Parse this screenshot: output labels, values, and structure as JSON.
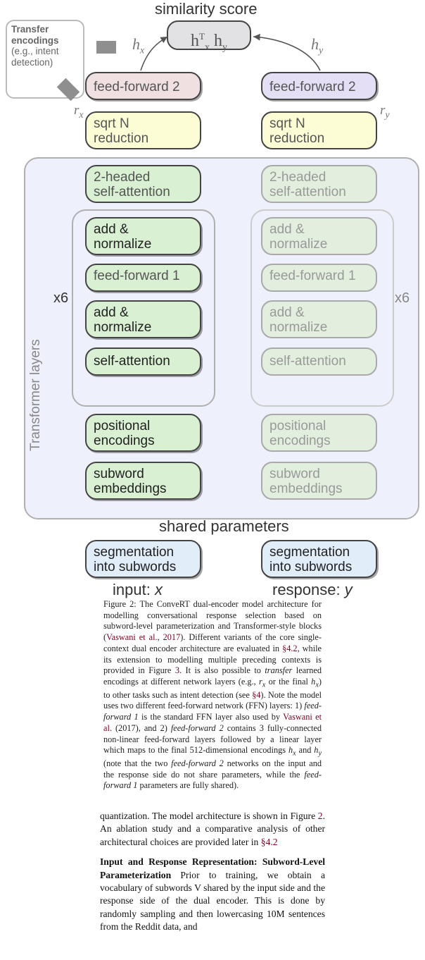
{
  "diagram": {
    "top_label": "similarity score",
    "score_box": "hₓᵀ hᵧ",
    "hx": "h",
    "hx_sub": "x",
    "hy": "h",
    "hy_sub": "y",
    "rx": "r",
    "rx_sub": "x",
    "ry": "r",
    "ry_sub": "y",
    "transfer_title": "Transfer encodings",
    "transfer_sub": "(e.g., intent detection)",
    "ff2_left": "feed-forward 2",
    "ff2_right": "feed-forward 2",
    "sqrtN_left": "sqrt N\nreduction",
    "sqrtN_right": "sqrt N\nreduction",
    "twohead_left": "2-headed\nself-attention",
    "twohead_right": "2-headed\nself-attention",
    "addnorm1_left": "add &\nnormalize",
    "addnorm1_right": "add &\nnormalize",
    "ff1_left": "feed-forward 1",
    "ff1_right": "feed-forward 1",
    "addnorm2_left": "add &\nnormalize",
    "addnorm2_right": "add &\nnormalize",
    "selfattn_left": "self-attention",
    "selfattn_right": "self-attention",
    "posenc_left": "positional\nencodings",
    "posenc_right": "positional\nencodings",
    "subword_left": "subword\nembeddings",
    "subword_right": "subword\nembeddings",
    "seg_left": "segmentation\ninto subwords",
    "seg_right": "segmentation\ninto subwords",
    "x6": "x6",
    "shared": "shared parameters",
    "transformer_label": "Transformer layers",
    "input_label": "input: x",
    "response_label": "response: y"
  },
  "caption": {
    "lead": "Figure 2: The ConveRT dual-encoder model architecture for modelling conversational response selection based on subword-level parameterization and Transformer-style blocks (",
    "ref_vaswani": "Vaswani et al., 2017",
    "after_vaswani": "). Different variants of the core single-context dual encoder architecture are evaluated in ",
    "sec42": "§4.2",
    "after42": ", while its extension to modelling multiple preceding contexts is provided in Figure ",
    "fig3": "3",
    "afterfig3": ". It is also possible to ",
    "it_transfer": "transfer",
    "after_transfer": " learned encodings at different network layers (e.g., ",
    "rx": "r",
    "rx_sub": "x",
    "or": " or the final ",
    "hx": "h",
    "hx_sub": "x",
    "after_hr": ") to other tasks such as intent detection (see ",
    "sec4": "§4",
    "after4": "). Note the model uses two different feed-forward network (FFN) layers: 1) ",
    "ff1": "feed-forward 1",
    "after_ff1": " is the standard FFN layer also used by ",
    "ref_vaswani2": "Vaswani et al.",
    "vaswani_year": " (2017)",
    "after_vaswani2": ", and 2) ",
    "ff2": "feed-forward 2",
    "after_ff2": " contains 3 fully-connected non-linear feed-forward layers followed by a linear layer which maps to the final 512-dimensional encodings ",
    "hx2": "h",
    "hx2_sub": "x",
    "and": " and ",
    "hy2": "h",
    "hy2_sub": "y",
    "tail": " (note that the two ",
    "ff2b": "feed-forward 2",
    "tail2": " networks on the input and the response side do not share parameters, while the ",
    "ff1b": "feed-forward 1",
    "tail3": " parameters are fully shared)."
  },
  "body": {
    "p1a": "quantization. The model architecture is shown in Figure ",
    "fig2": "2",
    "p1b": ". An ablation study and a comparative analysis of other architectural choices are provided later in ",
    "sec42": "§4.2",
    "p2_head": "Input and Response Representation: Subword-Level Parameterization",
    "p2_body": " Prior to training, we obtain a vocabulary of subwords V shared by the input side and the response side of the dual encoder. This is done by randomly sampling and then lowercasing 10M sentences from the Reddit data, and"
  }
}
